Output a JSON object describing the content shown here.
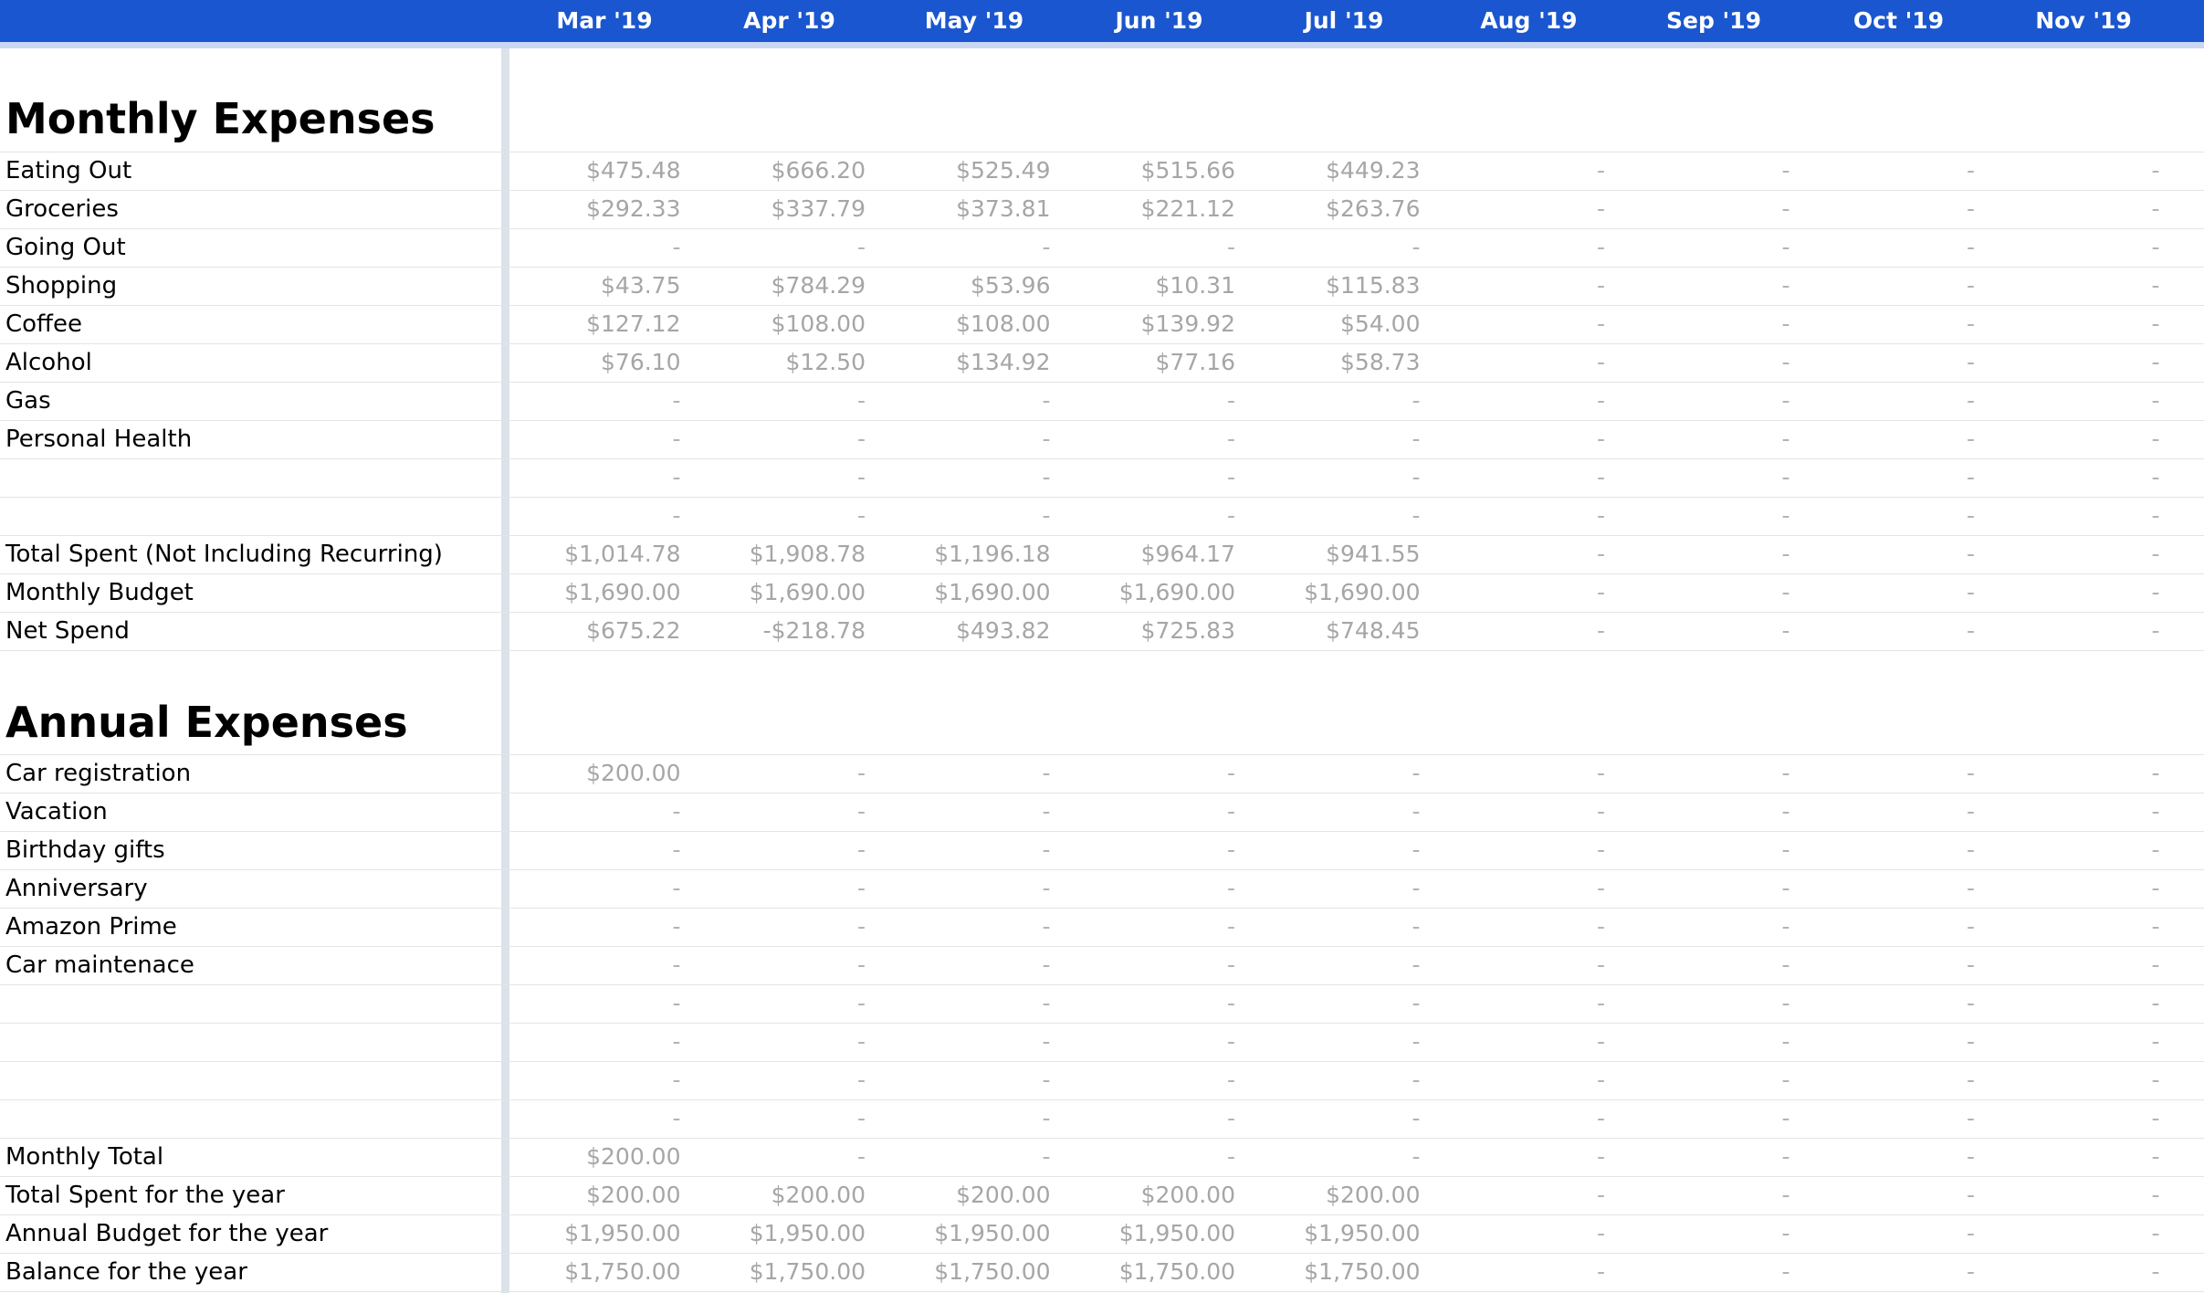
{
  "months": [
    "Mar '19",
    "Apr '19",
    "May '19",
    "Jun '19",
    "Jul '19",
    "Aug '19",
    "Sep '19",
    "Oct '19",
    "Nov '19"
  ],
  "sections": [
    {
      "title": "Monthly Expenses",
      "rows": [
        {
          "label": "Eating Out",
          "values": [
            "$475.48",
            "$666.20",
            "$525.49",
            "$515.66",
            "$449.23",
            "-",
            "-",
            "-",
            "-"
          ]
        },
        {
          "label": "Groceries",
          "values": [
            "$292.33",
            "$337.79",
            "$373.81",
            "$221.12",
            "$263.76",
            "-",
            "-",
            "-",
            "-"
          ]
        },
        {
          "label": "Going Out",
          "values": [
            "-",
            "-",
            "-",
            "-",
            "-",
            "-",
            "-",
            "-",
            "-"
          ]
        },
        {
          "label": "Shopping",
          "values": [
            "$43.75",
            "$784.29",
            "$53.96",
            "$10.31",
            "$115.83",
            "-",
            "-",
            "-",
            "-"
          ]
        },
        {
          "label": "Coffee",
          "values": [
            "$127.12",
            "$108.00",
            "$108.00",
            "$139.92",
            "$54.00",
            "-",
            "-",
            "-",
            "-"
          ]
        },
        {
          "label": "Alcohol",
          "values": [
            "$76.10",
            "$12.50",
            "$134.92",
            "$77.16",
            "$58.73",
            "-",
            "-",
            "-",
            "-"
          ]
        },
        {
          "label": "Gas",
          "values": [
            "-",
            "-",
            "-",
            "-",
            "-",
            "-",
            "-",
            "-",
            "-"
          ]
        },
        {
          "label": "Personal Health",
          "values": [
            "-",
            "-",
            "-",
            "-",
            "-",
            "-",
            "-",
            "-",
            "-"
          ]
        },
        {
          "label": "",
          "values": [
            "-",
            "-",
            "-",
            "-",
            "-",
            "-",
            "-",
            "-",
            "-"
          ]
        },
        {
          "label": "",
          "values": [
            "-",
            "-",
            "-",
            "-",
            "-",
            "-",
            "-",
            "-",
            "-"
          ]
        },
        {
          "label": "Total Spent (Not Including Recurring)",
          "values": [
            "$1,014.78",
            "$1,908.78",
            "$1,196.18",
            "$964.17",
            "$941.55",
            "-",
            "-",
            "-",
            "-"
          ]
        },
        {
          "label": "Monthly Budget",
          "values": [
            "$1,690.00",
            "$1,690.00",
            "$1,690.00",
            "$1,690.00",
            "$1,690.00",
            "-",
            "-",
            "-",
            "-"
          ]
        },
        {
          "label": "Net Spend",
          "values": [
            "$675.22",
            "-$218.78",
            "$493.82",
            "$725.83",
            "$748.45",
            "-",
            "-",
            "-",
            "-"
          ]
        }
      ]
    },
    {
      "title": "Annual Expenses",
      "rows": [
        {
          "label": "Car registration",
          "values": [
            "$200.00",
            "-",
            "-",
            "-",
            "-",
            "-",
            "-",
            "-",
            "-"
          ]
        },
        {
          "label": "Vacation",
          "values": [
            "-",
            "-",
            "-",
            "-",
            "-",
            "-",
            "-",
            "-",
            "-"
          ]
        },
        {
          "label": "Birthday gifts",
          "values": [
            "-",
            "-",
            "-",
            "-",
            "-",
            "-",
            "-",
            "-",
            "-"
          ]
        },
        {
          "label": "Anniversary",
          "values": [
            "-",
            "-",
            "-",
            "-",
            "-",
            "-",
            "-",
            "-",
            "-"
          ]
        },
        {
          "label": "Amazon Prime",
          "values": [
            "-",
            "-",
            "-",
            "-",
            "-",
            "-",
            "-",
            "-",
            "-"
          ]
        },
        {
          "label": "Car maintenace",
          "values": [
            "-",
            "-",
            "-",
            "-",
            "-",
            "-",
            "-",
            "-",
            "-"
          ]
        },
        {
          "label": "",
          "values": [
            "-",
            "-",
            "-",
            "-",
            "-",
            "-",
            "-",
            "-",
            "-"
          ]
        },
        {
          "label": "",
          "values": [
            "-",
            "-",
            "-",
            "-",
            "-",
            "-",
            "-",
            "-",
            "-"
          ]
        },
        {
          "label": "",
          "values": [
            "-",
            "-",
            "-",
            "-",
            "-",
            "-",
            "-",
            "-",
            "-"
          ]
        },
        {
          "label": "",
          "values": [
            "-",
            "-",
            "-",
            "-",
            "-",
            "-",
            "-",
            "-",
            "-"
          ]
        },
        {
          "label": "Monthly Total",
          "values": [
            "$200.00",
            "-",
            "-",
            "-",
            "-",
            "-",
            "-",
            "-",
            "-"
          ]
        },
        {
          "label": "Total Spent for the year",
          "values": [
            "$200.00",
            "$200.00",
            "$200.00",
            "$200.00",
            "$200.00",
            "-",
            "-",
            "-",
            "-"
          ]
        },
        {
          "label": "Annual Budget for the year",
          "values": [
            "$1,950.00",
            "$1,950.00",
            "$1,950.00",
            "$1,950.00",
            "$1,950.00",
            "-",
            "-",
            "-",
            "-"
          ]
        },
        {
          "label": "Balance for the year",
          "values": [
            "$1,750.00",
            "$1,750.00",
            "$1,750.00",
            "$1,750.00",
            "$1,750.00",
            "-",
            "-",
            "-",
            "-"
          ]
        }
      ]
    }
  ],
  "colors": {
    "header_bg": "#1a56cf",
    "header_text": "#ffffff",
    "value_text": "#a6a6a6",
    "label_text": "#000000",
    "gridline": "#e4e4e4"
  }
}
